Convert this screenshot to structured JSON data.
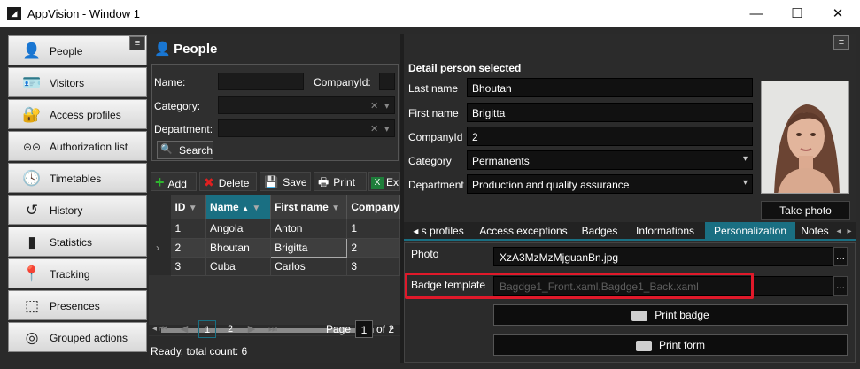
{
  "window": {
    "title": "AppVision - Window 1",
    "logo_glyph": "◢",
    "minimize": "—",
    "maximize": "☐",
    "close": "✕"
  },
  "nav": {
    "menu_glyph": "≡",
    "items": [
      {
        "label": "People",
        "icon": "person-icon",
        "glyph": "👤"
      },
      {
        "label": "Visitors",
        "icon": "visitor-card-icon",
        "glyph": "🪪"
      },
      {
        "label": "Access profiles",
        "icon": "access-profile-icon",
        "glyph": "🔐"
      },
      {
        "label": "Authorization list",
        "icon": "authorization-icon",
        "glyph": "⊝⊝"
      },
      {
        "label": "Timetables",
        "icon": "clock-icon",
        "glyph": "🕓"
      },
      {
        "label": "History",
        "icon": "history-icon",
        "glyph": "↺"
      },
      {
        "label": "Statistics",
        "icon": "bar-chart-icon",
        "glyph": "▮"
      },
      {
        "label": "Tracking",
        "icon": "location-pin-icon",
        "glyph": "📍"
      },
      {
        "label": "Presences",
        "icon": "presences-icon",
        "glyph": "⬚"
      },
      {
        "label": "Grouped actions",
        "icon": "grouped-actions-icon",
        "glyph": "◎"
      }
    ]
  },
  "people": {
    "title": "People",
    "title_glyph": "👤",
    "filters": {
      "name_label": "Name:",
      "companyid_label": "CompanyId:",
      "category_label": "Category:",
      "department_label": "Department:",
      "clear_glyph": "✕",
      "dropdown_glyph": "▾",
      "search_label": "Search",
      "search_glyph": "🔍"
    },
    "toolbar": {
      "add": "Add",
      "add_glyph": "+",
      "delete": "Delete",
      "delete_glyph": "✖",
      "save": "Save",
      "save_glyph": "💾",
      "print": "Print",
      "print_glyph": "🖶",
      "export": "Ex",
      "export_glyph": "X"
    },
    "grid": {
      "headers": [
        "ID",
        "Name",
        "First name",
        "Company"
      ],
      "filter_glyph": "▼",
      "sort_glyph": "▲",
      "row_indicator": "›",
      "rows": [
        {
          "id": "1",
          "name": "Angola",
          "first": "Anton",
          "company": "1"
        },
        {
          "id": "2",
          "name": "Bhoutan",
          "first": "Brigitta",
          "company": "2"
        },
        {
          "id": "3",
          "name": "Cuba",
          "first": "Carlos",
          "company": "3"
        }
      ],
      "scroll_left": "◂",
      "scroll_right": "▸"
    },
    "pager": {
      "first": "⏮",
      "prev": "◀",
      "pages": [
        "1",
        "2"
      ],
      "next": "▶",
      "last": "⏭",
      "page_label": "Page",
      "page_value": "1",
      "of_label": "of 2"
    },
    "status": "Ready, total count: 6"
  },
  "detail": {
    "menu_glyph": "≡",
    "title": "Detail person selected",
    "last_name_label": "Last name",
    "last_name": "Bhoutan",
    "first_name_label": "First name",
    "first_name": "Brigitta",
    "companyid_label": "CompanyId",
    "companyid": "2",
    "category_label": "Category",
    "category": "Permanents",
    "department_label": "Department",
    "department": "Production and quality assurance",
    "dropdown_glyph": "▾",
    "take_photo": "Take photo",
    "tabs": [
      "◂  s profiles",
      "Access exceptions",
      "Badges",
      "Informations",
      "Personalization",
      "Notes",
      "◂",
      "▸"
    ],
    "personalization": {
      "photo_label": "Photo",
      "photo_value": "XzA3MzMzMjguanBn.jpg",
      "badge_template_label": "Badge template",
      "badge_template_value": "Bagdge1_Front.xaml,Bagdge1_Back.xaml",
      "browse_glyph": "...",
      "print_badge": "Print badge",
      "print_form": "Print form"
    }
  },
  "colors": {
    "accent": "#1a6f82",
    "highlight": "#e0192a",
    "panel": "#2b2b2b"
  }
}
